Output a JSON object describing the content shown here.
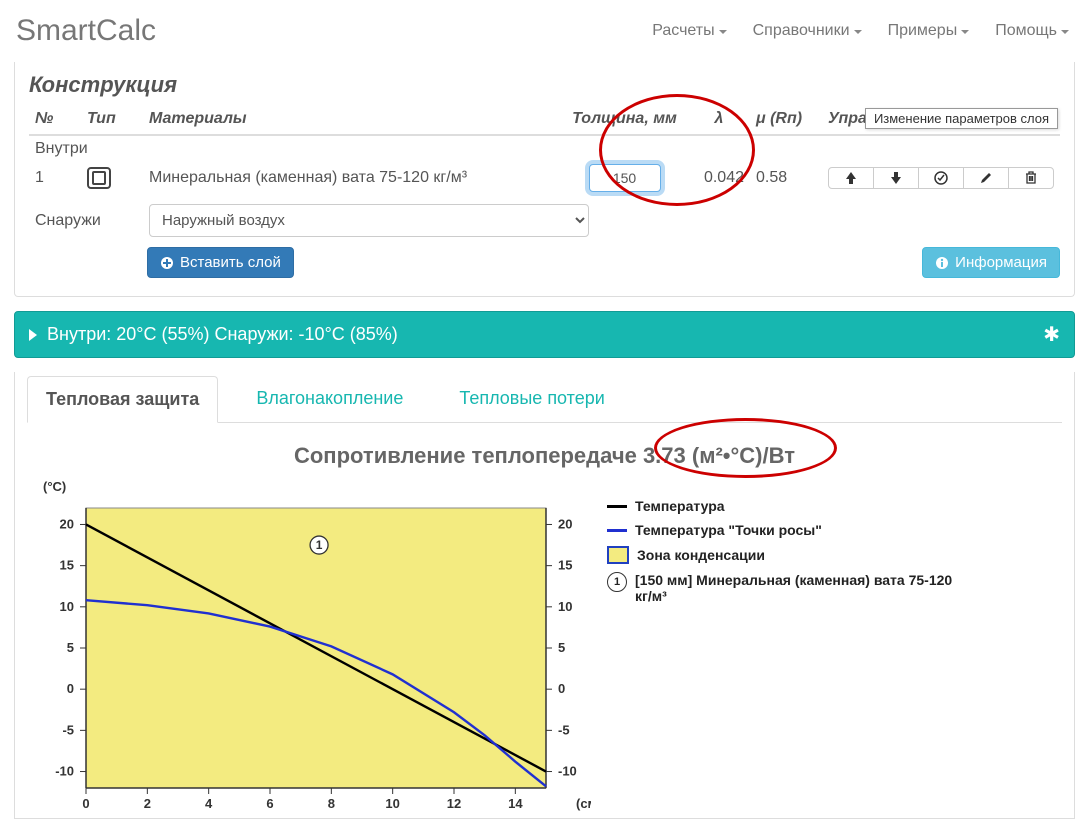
{
  "brand": "SmartCalc",
  "nav": {
    "calc": "Расчеты",
    "ref": "Справочники",
    "ex": "Примеры",
    "help": "Помощь"
  },
  "panel": {
    "title": "Конструкция",
    "headers": {
      "num": "№",
      "type": "Тип",
      "materials": "Материалы",
      "thickness": "Толщина, мм",
      "lambda": "λ",
      "mu": "μ (Rп)",
      "manage": "Управление"
    },
    "inside_label": "Внутри",
    "outside_label": "Снаружи",
    "row": {
      "num": "1",
      "material": "Минеральная (каменная) вата 75-120 кг/м³",
      "thickness": "150",
      "lambda": "0.042",
      "mu": "0.58"
    },
    "outside_air": "Наружный воздух",
    "insert_btn": "Вставить слой",
    "info_btn": "Информация",
    "tooltip": "Изменение параметров слоя"
  },
  "conditions": "Внутри: 20°C (55%) Снаружи: -10°C (85%)",
  "tabs": {
    "thermal": "Тепловая защита",
    "moisture": "Влагонакопление",
    "losses": "Тепловые потери"
  },
  "result_title_prefix": "Сопротивление теплопередаче ",
  "result_value": "3.73 (м²•°С)/Вт",
  "legend": {
    "temp": "Температура",
    "dew": "Температура \"Точки росы\"",
    "cond": "Зона конденсации",
    "layer_idx": "1",
    "layer_desc": "[150 мм] Минеральная (каменная) вата 75-120 кг/м³"
  },
  "chart_units": {
    "y": "(°C)",
    "x": "(см)"
  },
  "chart_data": {
    "type": "line",
    "xlabel": "см",
    "ylabel": "°C",
    "xlim": [
      0,
      15
    ],
    "ylim": [
      -12,
      22
    ],
    "xticks": [
      0,
      2,
      4,
      6,
      8,
      10,
      12,
      14
    ],
    "yticks": [
      -10,
      -5,
      0,
      5,
      10,
      15,
      20
    ],
    "annotations": [
      {
        "text": "1",
        "x": 7.6,
        "y": 17.5,
        "circle": true
      }
    ],
    "series": [
      {
        "name": "Температура",
        "color": "#000000",
        "x": [
          0,
          15
        ],
        "values": [
          20,
          -10
        ]
      },
      {
        "name": "Температура \"Точки росы\"",
        "color": "#2030d0",
        "x": [
          0,
          2,
          4,
          6,
          8,
          10,
          12,
          13,
          14,
          15
        ],
        "values": [
          10.8,
          10.2,
          9.2,
          7.6,
          5.2,
          1.8,
          -2.8,
          -5.6,
          -8.8,
          -11.8
        ]
      }
    ],
    "fill_region": {
      "x0": 0,
      "x1": 15,
      "color": "#f3eb80"
    }
  }
}
